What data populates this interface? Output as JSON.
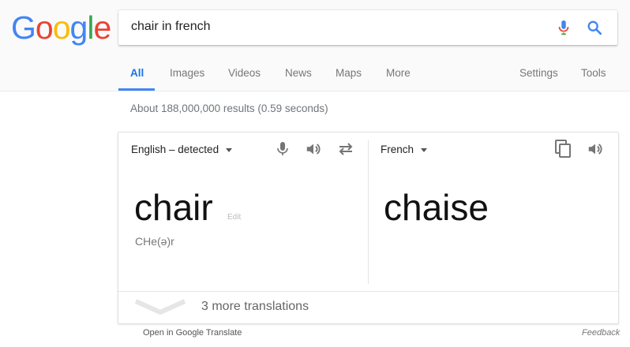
{
  "logo": {
    "letters": [
      "G",
      "o",
      "o",
      "g",
      "l",
      "e"
    ],
    "colors": [
      "#4285f4",
      "#ea4335",
      "#fbbc05",
      "#4285f4",
      "#34a853",
      "#ea4335"
    ]
  },
  "search": {
    "query": "chair in french"
  },
  "tabs": {
    "all": "All",
    "images": "Images",
    "videos": "Videos",
    "news": "News",
    "maps": "Maps",
    "more": "More",
    "settings": "Settings",
    "tools": "Tools",
    "active": "All"
  },
  "result_stats": "About 188,000,000 results (0.59 seconds)",
  "translate": {
    "source_lang": "English – detected",
    "target_lang": "French",
    "source_word": "chair",
    "edit_label": "Edit",
    "pronunciation": "CHe(ə)r",
    "target_word": "chaise",
    "more_translations": "3 more translations",
    "open_in_translate": "Open in Google Translate",
    "feedback": "Feedback",
    "icons": [
      "mic-icon",
      "speaker-icon",
      "swap-icon",
      "copy-icon",
      "speaker-icon",
      "chevron-down-icon"
    ]
  },
  "colors": {
    "accent": "#4285f4",
    "tab_inactive": "#777777",
    "stats": "#70757a"
  }
}
